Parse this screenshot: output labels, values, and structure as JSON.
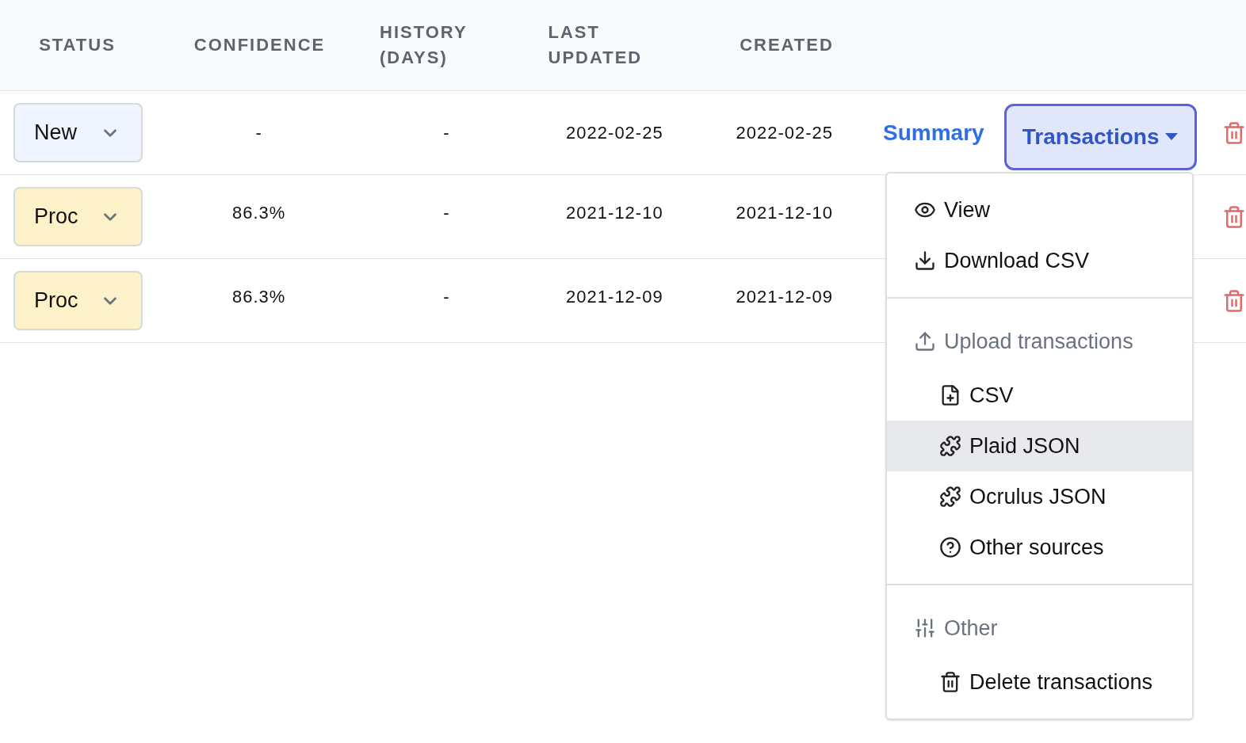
{
  "table": {
    "columns": [
      "STATUS",
      "CONFIDENCE",
      "HISTORY (DAYS)",
      "LAST UPDATED",
      "CREATED"
    ],
    "rows": [
      {
        "status": {
          "label": "New",
          "kind": "new"
        },
        "confidence": "-",
        "history": "-",
        "last_updated": "2022-02-25",
        "created": "2022-02-25",
        "summary_link": "Summary",
        "transactions_button": {
          "label": "Transactions",
          "expanded": true
        }
      },
      {
        "status": {
          "label": "Proc",
          "kind": "processing"
        },
        "confidence": "86.3%",
        "history": "-",
        "last_updated": "2021-12-10",
        "created": "2021-12-10"
      },
      {
        "status": {
          "label": "Proc",
          "kind": "processing"
        },
        "confidence": "86.3%",
        "history": "-",
        "last_updated": "2021-12-09",
        "created": "2021-12-09"
      }
    ]
  },
  "transactions_menu": {
    "sections": [
      {
        "items": [
          {
            "label": "View",
            "selected": false
          },
          {
            "label": "Download CSV",
            "selected": false
          }
        ]
      },
      {
        "header": "Upload transactions",
        "items": [
          {
            "label": "CSV",
            "selected": false
          },
          {
            "label": "Plaid JSON",
            "selected": true
          },
          {
            "label": "Ocrulus JSON",
            "selected": false
          },
          {
            "label": "Other sources",
            "selected": false
          }
        ]
      },
      {
        "header": "Other",
        "items": [
          {
            "label": "Delete transactions",
            "selected": false
          }
        ]
      }
    ]
  }
}
